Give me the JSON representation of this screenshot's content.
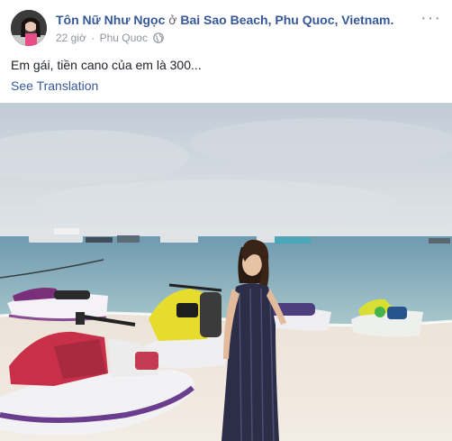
{
  "post": {
    "author": "Tôn Nữ Như Ngọc",
    "at_word": "ở",
    "location": "Bai Sao Beach, Phu Quoc, Vietnam.",
    "time": "22 giờ",
    "separator": "·",
    "place": "Phu Quoc",
    "text": "Em gái, tiền cano của em là 300...",
    "see_translation": "See Translation",
    "more": "···"
  },
  "icons": {
    "avatar": "profile-photo",
    "privacy": "globe-icon",
    "menu": "more-options-icon"
  },
  "colors": {
    "link": "#365899",
    "meta": "#90949c",
    "text": "#1d2129"
  }
}
